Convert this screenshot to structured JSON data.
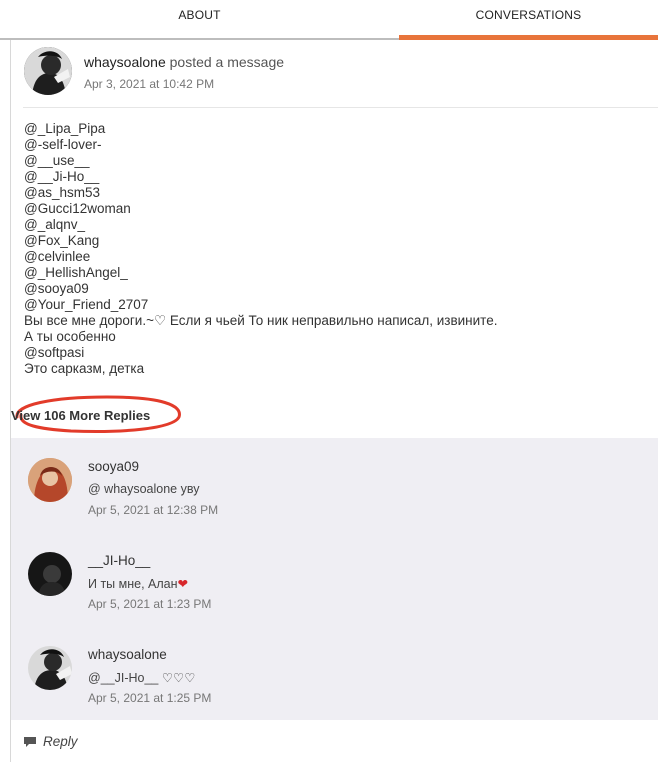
{
  "tabs": {
    "about": "ABOUT",
    "conversations": "CONVERSATIONS",
    "active": "CONVERSATIONS",
    "accent_color": "#e8743b"
  },
  "post": {
    "author": "whaysoalone",
    "action": "posted a message",
    "timestamp": "Apr 3, 2021 at 10:42 PM",
    "lines": [
      "@_Lipa_Pipa",
      "@-self-lover-",
      "@__use__",
      "@__Ji-Ho__",
      "@as_hsm53",
      "@Gucci12woman",
      "@_alqnv_",
      "@Fox_Kang",
      "@celvinlee",
      "@_HellishAngel_",
      "@sooya09",
      "@Your_Friend_2707",
      "Вы все мне дороги.~♡ Если я чьей То ник неправильно написал, извините.",
      "А ты особенно",
      "@softpasi",
      "Это сарказм, детка"
    ]
  },
  "more_replies": "View 106 More Replies",
  "replies": [
    {
      "name": "sooya09",
      "text": "@ whaysoalone  уву",
      "time": "Apr 5, 2021 at 12:38 PM"
    },
    {
      "name": "__JI-Ho__",
      "text": "И ты мне,  Алан",
      "heart": "❤",
      "time": "Apr 5, 2021 at 1:23 PM"
    },
    {
      "name": "whaysoalone",
      "text": "@__JI-Ho__ ♡♡♡",
      "time": "Apr 5, 2021 at 1:25 PM"
    }
  ],
  "reply_button": {
    "label": "Reply",
    "icon": "speech-bubble-icon"
  }
}
